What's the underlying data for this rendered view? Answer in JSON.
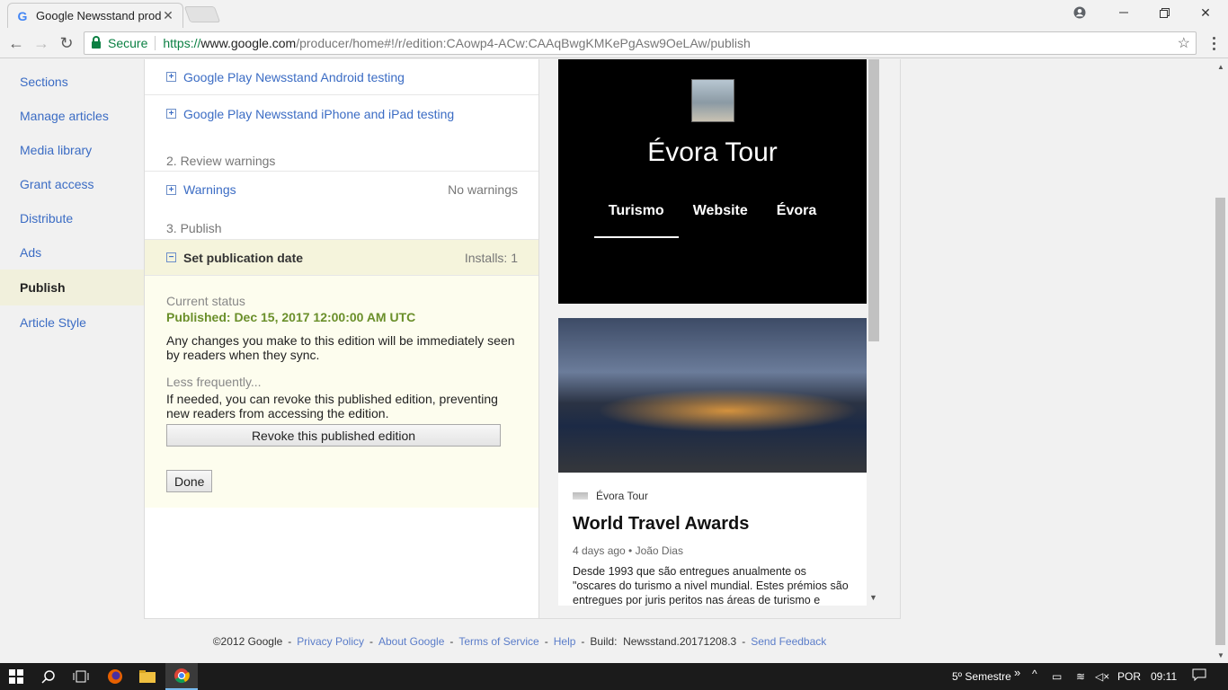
{
  "browser": {
    "tab_title": "Google Newsstand producer",
    "tab_icon": "G",
    "url_secure_label": "Secure",
    "url_scheme": "https://",
    "url_host": "www.google.com",
    "url_path": "/producer/home#!/r/edition:CAowp4-ACw:CAAqBwgKMKePgAsw9OeLAw/publish"
  },
  "sidebar": {
    "items": [
      {
        "label": "Sections"
      },
      {
        "label": "Manage articles"
      },
      {
        "label": "Media library"
      },
      {
        "label": "Grant access"
      },
      {
        "label": "Distribute"
      },
      {
        "label": "Ads"
      },
      {
        "label": "Publish"
      },
      {
        "label": "Article Style"
      }
    ]
  },
  "main": {
    "testing": [
      {
        "label": "Google Play Newsstand Android testing"
      },
      {
        "label": "Google Play Newsstand iPhone and iPad testing"
      }
    ],
    "review_heading": "2. Review warnings",
    "warnings_label": "Warnings",
    "warnings_status": "No warnings",
    "publish_heading": "3. Publish",
    "set_date_label": "Set publication date",
    "installs": "Installs: 1",
    "current_status_label": "Current status",
    "published_status": "Published: Dec 15, 2017 12:00:00 AM UTC",
    "changes_text": "Any changes you make to this edition will be immediately seen by readers when they sync.",
    "less_frequently": "Less frequently...",
    "revoke_text": "If needed, you can revoke this published edition, preventing new readers from accessing the edition.",
    "revoke_button": "Revoke this published edition",
    "done_button": "Done"
  },
  "preview": {
    "title": "Évora Tour",
    "tabs": [
      "Turismo",
      "Website",
      "Évora"
    ],
    "card": {
      "source": "Évora Tour",
      "headline": "World Travel Awards",
      "meta": "4 days ago • João Dias",
      "excerpt": "Desde 1993 que são entregues anualmente os \"oscares do turismo a nivel mundial. Estes prémios são entregues por juris peritos nas áreas de turismo e"
    }
  },
  "footer": {
    "copyright": "©2012 Google",
    "privacy": "Privacy Policy",
    "about": "About Google",
    "terms": "Terms of Service",
    "help": "Help",
    "build_label": "Build:",
    "build_value": "Newsstand.20171208.3",
    "feedback": "Send Feedback"
  },
  "taskbar": {
    "tray_label": "5º Semestre",
    "language": "POR",
    "time": "09:11"
  }
}
